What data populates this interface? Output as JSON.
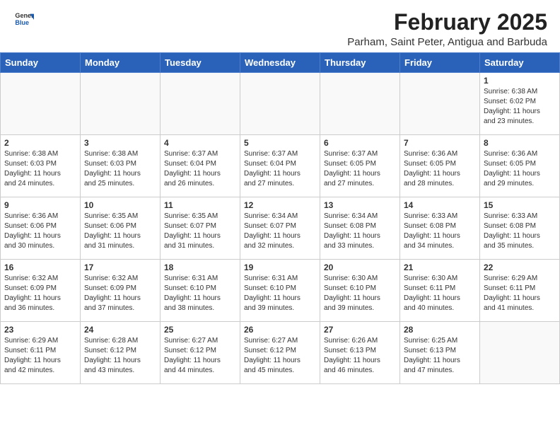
{
  "logo": {
    "general": "General",
    "blue": "Blue"
  },
  "title": "February 2025",
  "subtitle": "Parham, Saint Peter, Antigua and Barbuda",
  "weekdays": [
    "Sunday",
    "Monday",
    "Tuesday",
    "Wednesday",
    "Thursday",
    "Friday",
    "Saturday"
  ],
  "weeks": [
    [
      {
        "day": "",
        "info": ""
      },
      {
        "day": "",
        "info": ""
      },
      {
        "day": "",
        "info": ""
      },
      {
        "day": "",
        "info": ""
      },
      {
        "day": "",
        "info": ""
      },
      {
        "day": "",
        "info": ""
      },
      {
        "day": "1",
        "info": "Sunrise: 6:38 AM\nSunset: 6:02 PM\nDaylight: 11 hours\nand 23 minutes."
      }
    ],
    [
      {
        "day": "2",
        "info": "Sunrise: 6:38 AM\nSunset: 6:03 PM\nDaylight: 11 hours\nand 24 minutes."
      },
      {
        "day": "3",
        "info": "Sunrise: 6:38 AM\nSunset: 6:03 PM\nDaylight: 11 hours\nand 25 minutes."
      },
      {
        "day": "4",
        "info": "Sunrise: 6:37 AM\nSunset: 6:04 PM\nDaylight: 11 hours\nand 26 minutes."
      },
      {
        "day": "5",
        "info": "Sunrise: 6:37 AM\nSunset: 6:04 PM\nDaylight: 11 hours\nand 27 minutes."
      },
      {
        "day": "6",
        "info": "Sunrise: 6:37 AM\nSunset: 6:05 PM\nDaylight: 11 hours\nand 27 minutes."
      },
      {
        "day": "7",
        "info": "Sunrise: 6:36 AM\nSunset: 6:05 PM\nDaylight: 11 hours\nand 28 minutes."
      },
      {
        "day": "8",
        "info": "Sunrise: 6:36 AM\nSunset: 6:05 PM\nDaylight: 11 hours\nand 29 minutes."
      }
    ],
    [
      {
        "day": "9",
        "info": "Sunrise: 6:36 AM\nSunset: 6:06 PM\nDaylight: 11 hours\nand 30 minutes."
      },
      {
        "day": "10",
        "info": "Sunrise: 6:35 AM\nSunset: 6:06 PM\nDaylight: 11 hours\nand 31 minutes."
      },
      {
        "day": "11",
        "info": "Sunrise: 6:35 AM\nSunset: 6:07 PM\nDaylight: 11 hours\nand 31 minutes."
      },
      {
        "day": "12",
        "info": "Sunrise: 6:34 AM\nSunset: 6:07 PM\nDaylight: 11 hours\nand 32 minutes."
      },
      {
        "day": "13",
        "info": "Sunrise: 6:34 AM\nSunset: 6:08 PM\nDaylight: 11 hours\nand 33 minutes."
      },
      {
        "day": "14",
        "info": "Sunrise: 6:33 AM\nSunset: 6:08 PM\nDaylight: 11 hours\nand 34 minutes."
      },
      {
        "day": "15",
        "info": "Sunrise: 6:33 AM\nSunset: 6:08 PM\nDaylight: 11 hours\nand 35 minutes."
      }
    ],
    [
      {
        "day": "16",
        "info": "Sunrise: 6:32 AM\nSunset: 6:09 PM\nDaylight: 11 hours\nand 36 minutes."
      },
      {
        "day": "17",
        "info": "Sunrise: 6:32 AM\nSunset: 6:09 PM\nDaylight: 11 hours\nand 37 minutes."
      },
      {
        "day": "18",
        "info": "Sunrise: 6:31 AM\nSunset: 6:10 PM\nDaylight: 11 hours\nand 38 minutes."
      },
      {
        "day": "19",
        "info": "Sunrise: 6:31 AM\nSunset: 6:10 PM\nDaylight: 11 hours\nand 39 minutes."
      },
      {
        "day": "20",
        "info": "Sunrise: 6:30 AM\nSunset: 6:10 PM\nDaylight: 11 hours\nand 39 minutes."
      },
      {
        "day": "21",
        "info": "Sunrise: 6:30 AM\nSunset: 6:11 PM\nDaylight: 11 hours\nand 40 minutes."
      },
      {
        "day": "22",
        "info": "Sunrise: 6:29 AM\nSunset: 6:11 PM\nDaylight: 11 hours\nand 41 minutes."
      }
    ],
    [
      {
        "day": "23",
        "info": "Sunrise: 6:29 AM\nSunset: 6:11 PM\nDaylight: 11 hours\nand 42 minutes."
      },
      {
        "day": "24",
        "info": "Sunrise: 6:28 AM\nSunset: 6:12 PM\nDaylight: 11 hours\nand 43 minutes."
      },
      {
        "day": "25",
        "info": "Sunrise: 6:27 AM\nSunset: 6:12 PM\nDaylight: 11 hours\nand 44 minutes."
      },
      {
        "day": "26",
        "info": "Sunrise: 6:27 AM\nSunset: 6:12 PM\nDaylight: 11 hours\nand 45 minutes."
      },
      {
        "day": "27",
        "info": "Sunrise: 6:26 AM\nSunset: 6:13 PM\nDaylight: 11 hours\nand 46 minutes."
      },
      {
        "day": "28",
        "info": "Sunrise: 6:25 AM\nSunset: 6:13 PM\nDaylight: 11 hours\nand 47 minutes."
      },
      {
        "day": "",
        "info": ""
      }
    ]
  ]
}
